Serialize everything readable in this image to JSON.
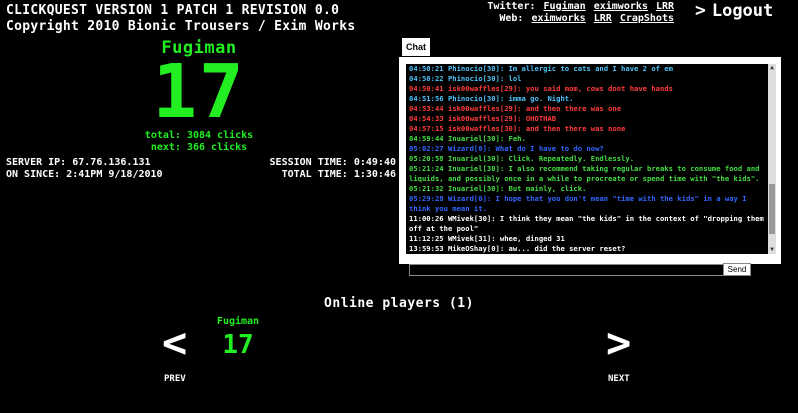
{
  "header": {
    "title_line1": "CLICKQUEST VERSION 1 PATCH 1 REVISION 0.0",
    "title_line2": "Copyright 2010 Bionic Trousers / Exim Works",
    "twitter_label": "Twitter:",
    "twitter_links": [
      "Fugiman",
      "eximworks",
      "LRR"
    ],
    "web_label": "Web:",
    "web_links": [
      "eximworks",
      "LRR",
      "CrapShots"
    ],
    "logout_icon": "chevron-right-icon",
    "logout_label": "Logout"
  },
  "player": {
    "name": "Fugiman",
    "count": "17",
    "total_label": "total:",
    "total_value": "3084 clicks",
    "next_label": "next:",
    "next_value": "366 clicks"
  },
  "server": {
    "ip_label": "SERVER IP:",
    "ip": "67.76.136.131",
    "since_label": "ON SINCE:",
    "since": "2:41PM 9/18/2010",
    "session_label": "SESSION TIME:",
    "session": "0:49:40",
    "total_label": "TOTAL TIME:",
    "total": "1:30:46"
  },
  "chat": {
    "tab_label": "Chat",
    "send_label": "Send",
    "input_value": "",
    "messages": [
      {
        "text": "04:50:21 Phinocio[30]: Im allergic to cats and I have 2 of em",
        "color": "#4fc3f7"
      },
      {
        "text": "04:50:22 Phinocio[30]: lol",
        "color": "#4fc3f7"
      },
      {
        "text": "04:50:41 isk00waffles[29]: you said mom, cows dont have hands",
        "color": "#ff3b3b"
      },
      {
        "text": "04:51:56 Phinocio[30]: imma go. Night.",
        "color": "#4fc3f7"
      },
      {
        "text": "04:53:44 isk00waffles[29]: and then there was one",
        "color": "#ff3b3b"
      },
      {
        "text": "04:54:33 isk00waffles[29]: OHOTHAB",
        "color": "#ff3b3b"
      },
      {
        "text": "04:57:15 isk00waffles[30]: and then there was none",
        "color": "#ff3b3b"
      },
      {
        "text": "04:59:44 Inuariel[30]: Feh.",
        "color": "#44dd44"
      },
      {
        "text": "05:02:27 Wizard[0]: What do I have to do now?",
        "color": "#3366ff"
      },
      {
        "text": "05:20:58 Inuariel[30]: Click. Repeatedly. Endlessly.",
        "color": "#44dd44"
      },
      {
        "text": "05:21:24 Inuariel[30]: I also recommend taking regular breaks to consume food and liquids, and possibly once in a while to procreate or spend time with \"the kids\".",
        "color": "#44dd44"
      },
      {
        "text": "05:21:32 Inuariel[30]: But mainly, click.",
        "color": "#44dd44"
      },
      {
        "text": "05:29:28 Wizard[0]: I hope that you don't mean \"time with the kids\" in a way I think you mean it.",
        "color": "#3366ff"
      },
      {
        "text": "11:00:26 WMivek[30]: I think they mean \"the kids\" in the context of \"dropping them off at the pool\"",
        "color": "#ffffff"
      },
      {
        "text": "11:12:25 WMivek[31]: whee, dinged 31",
        "color": "#ffffff"
      },
      {
        "text": "13:59:53 MikeOShay[0]: aw... did the server reset?",
        "color": "#ffffff"
      }
    ]
  },
  "online": {
    "title": "Online players (1)",
    "prev_label": "PREV",
    "next_label": "NEXT",
    "players": [
      {
        "name": "Fugiman",
        "count": "17"
      }
    ]
  }
}
